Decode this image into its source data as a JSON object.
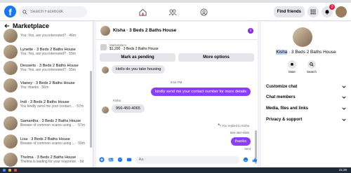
{
  "topbar": {
    "logo_letter": "f",
    "search_placeholder": "Search Facebook",
    "find_friends": "Find friends",
    "notification_count": "3"
  },
  "sidebar": {
    "title": "Marketplace",
    "conversations": [
      {
        "name": "",
        "snippet": "You: Yes, are you interested? · 46m"
      },
      {
        "name": "Lynette · 3 Beds 2 Baths House",
        "snippet": "You: Yes, are you interested? · 55m"
      },
      {
        "name": "Desserts · 3 Beds 2 Baths House",
        "snippet": "You: Yes, are you interested? · 55m"
      },
      {
        "name": "Vianey · 3 Beds 2 Baths House",
        "snippet": "You: thanks · 56m"
      },
      {
        "name": "Indi · 3 Beds 2 Baths House",
        "snippet": "You kindly send me your contact... · 57m"
      },
      {
        "name": "Samantha · 3 Beds 2 Baths House",
        "snippet": "Beware of common scams using ... · 57m"
      },
      {
        "name": "Lisa · 3 Beds 2 Baths House",
        "snippet": "Beware of common scams using ... · 59m"
      },
      {
        "name": "Thelma · 3 Beds 2 Baths House",
        "snippet": "Thelma is waiting for your response. · 5d"
      }
    ]
  },
  "chat": {
    "title": "Kisha · 3 Beds 2 Baths House",
    "market_label": "Marketplace",
    "market_price": "$1,200 · 3 Beds 2 Baths House",
    "mark_pending": "Mark as pending",
    "more_options": "More options",
    "messages": [
      {
        "text": "Hello do you take housing",
        "dir": "in"
      },
      {
        "text": "kindly send me your contact number for more details",
        "dir": "out"
      },
      {
        "text": "956-450-4065",
        "dir": "in"
      },
      {
        "text": "956-450-4065",
        "dir": "quote"
      },
      {
        "text": "thanks",
        "dir": "out"
      }
    ],
    "time_label": "9:54 PM",
    "sender_label": "Kisha",
    "replied_label": "You replied to Kisha",
    "sent_label": "Sent",
    "composer_placeholder": "Aa"
  },
  "info_panel": {
    "title_highlight": "Kisha",
    "title_rest": " · 3 Beds 2 Baths House",
    "mute": "Mute",
    "search": "Search",
    "sections": [
      "Customize chat",
      "Chat members",
      "Media, files and links",
      "Privacy & support"
    ]
  },
  "taskbar": {
    "clock": "21:29"
  },
  "colors": {
    "brand": "#1877f2",
    "outgoing_bubble": "#8b3dff"
  }
}
